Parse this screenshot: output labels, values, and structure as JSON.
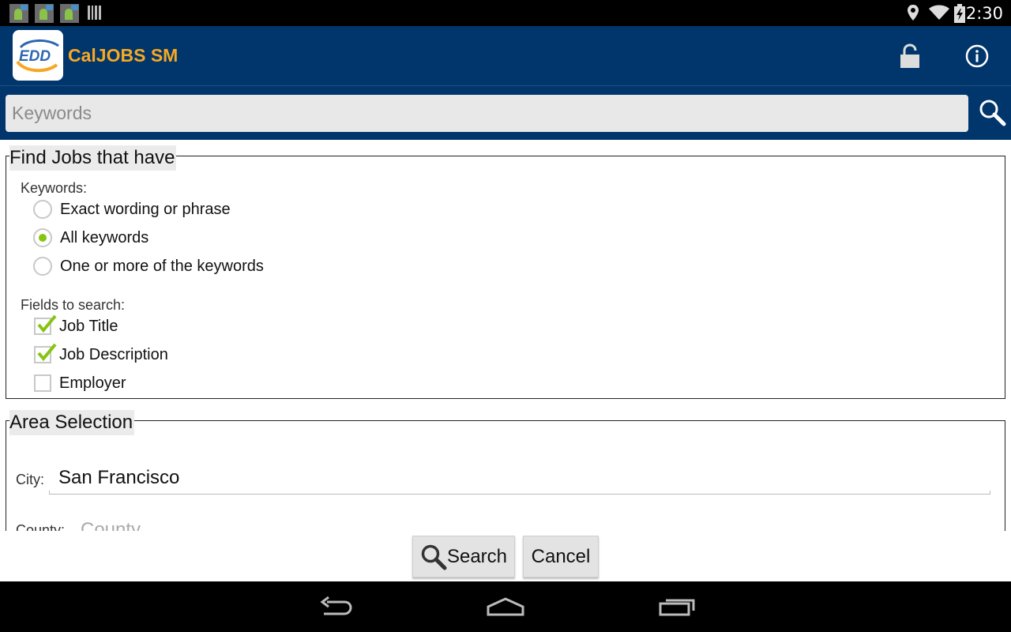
{
  "status_bar": {
    "time": "2:30",
    "notification_icons": [
      "android-icon",
      "android-icon",
      "android-icon",
      "barcode-icon"
    ],
    "system_icons": [
      "location-icon",
      "wifi-icon",
      "battery-icon"
    ]
  },
  "app_bar": {
    "logo_text": "EDD",
    "title": "CalJOBS SM",
    "actions": [
      "lock-icon",
      "info-icon"
    ]
  },
  "search": {
    "placeholder": "Keywords",
    "value": ""
  },
  "find_jobs": {
    "legend": "Find Jobs that have",
    "keywords_label": "Keywords:",
    "keyword_options": [
      {
        "label": "Exact wording or phrase",
        "selected": false
      },
      {
        "label": "All keywords",
        "selected": true
      },
      {
        "label": "One or more of the keywords",
        "selected": false
      }
    ],
    "fields_label": "Fields to search:",
    "field_options": [
      {
        "label": "Job Title",
        "checked": true
      },
      {
        "label": "Job Description",
        "checked": true
      },
      {
        "label": "Employer",
        "checked": false
      }
    ]
  },
  "area": {
    "legend": "Area Selection",
    "city_label": "City:",
    "city_value": "San Francisco",
    "county_label": "County:",
    "county_placeholder": "County"
  },
  "buttons": {
    "search": "Search",
    "cancel": "Cancel"
  },
  "colors": {
    "app_bar": "#00366b",
    "title": "#f7a823",
    "accent_green": "#86c412"
  }
}
